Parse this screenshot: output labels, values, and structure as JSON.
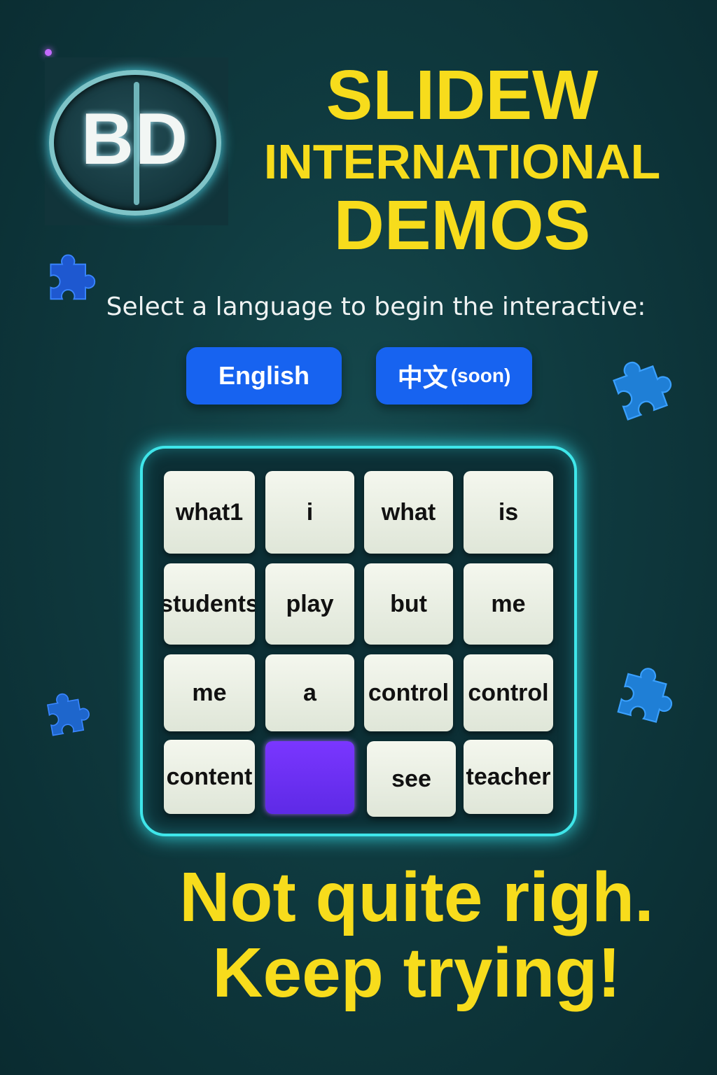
{
  "logo": {
    "text": "BD"
  },
  "title": {
    "line1": "SLIDEW",
    "line2": "INTERNATIONAL",
    "line3": "DEMOS"
  },
  "prompt": "Select a language to begin the interactive:",
  "languages": {
    "english": "English",
    "chinese": "中文",
    "chinese_note": "(soon)"
  },
  "board": {
    "tiles": [
      "what1",
      "i",
      "what",
      "is",
      "students",
      "play",
      "but",
      "me",
      "me",
      "a",
      "control",
      "control",
      "content",
      "",
      "see",
      "teacher"
    ],
    "highlighted_index": 13
  },
  "colors": {
    "title": "#f7dc1c",
    "button": "#1763f0",
    "board_glow": "#3fe6ea",
    "highlight_tile": "#6a2ff5",
    "puzzle_piece": "#1f6fd6"
  },
  "feedback": {
    "line1": "Not quite righ.",
    "line2": "Keep trying!"
  }
}
